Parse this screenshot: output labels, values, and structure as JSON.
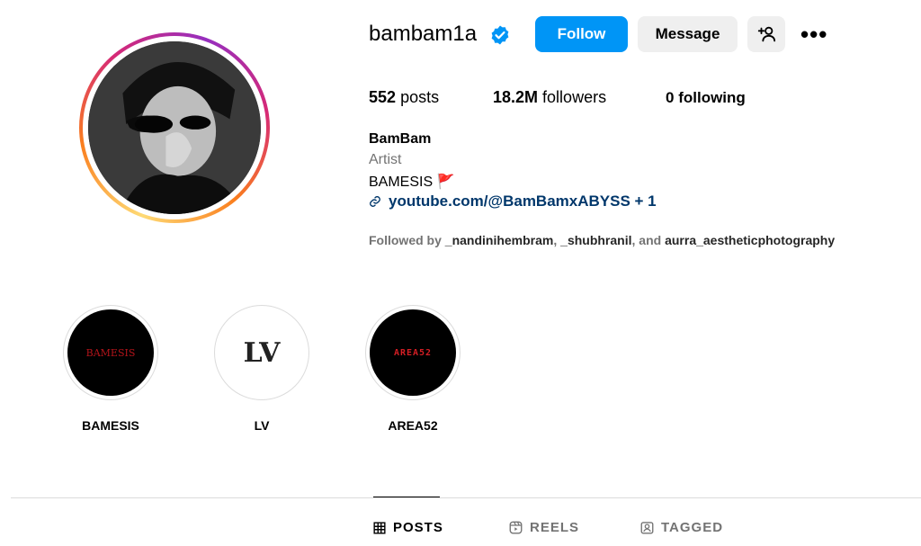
{
  "profile": {
    "username": "bambam1a",
    "display_name": "BamBam",
    "category": "Artist",
    "bio_line": "BAMESIS",
    "bio_emoji": "🚩",
    "link_text": "youtube.com/@BamBamxABYSS + 1",
    "verified_icon": "verified-badge-icon"
  },
  "actions": {
    "follow_label": "Follow",
    "message_label": "Message",
    "add_user_icon": "add-person-icon",
    "more_label": "•••"
  },
  "stats": {
    "posts_value": "552",
    "posts_label": "posts",
    "followers_value": "18.2M",
    "followers_label": "followers",
    "following_value": "0",
    "following_label": "following"
  },
  "followed_by": {
    "prefix": "Followed by",
    "user1": "_nandinihembram",
    "sep1": ",",
    "user2": "_shubhranil",
    "sep2": ", and",
    "user3": "aurra_aestheticphotography"
  },
  "highlights": [
    {
      "label": "BAMESIS",
      "cover_text": "BAMESIS"
    },
    {
      "label": "LV",
      "cover_text": "LV"
    },
    {
      "label": "AREA52",
      "cover_text": "AREA52"
    }
  ],
  "tabs": [
    {
      "label": "POSTS",
      "icon": "grid-icon",
      "active": true
    },
    {
      "label": "REELS",
      "icon": "reels-icon",
      "active": false
    },
    {
      "label": "TAGGED",
      "icon": "tagged-icon",
      "active": false
    }
  ],
  "colors": {
    "accent": "#0095f6",
    "link": "#00376b",
    "muted": "#737373",
    "button_gray": "#efefef"
  }
}
